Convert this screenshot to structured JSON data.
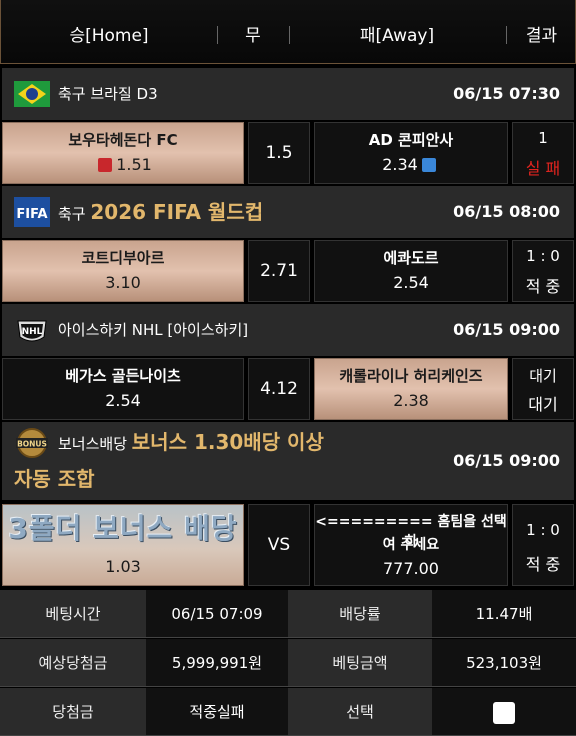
{
  "header": {
    "home": "승[Home]",
    "draw": "무",
    "away": "패[Away]",
    "result": "결과"
  },
  "matches": [
    {
      "sport_league": "축구 브라질 D3",
      "league_highlight": "",
      "datetime": "06/15 07:30",
      "icon": "brazil-flag-icon",
      "home": {
        "name": "보우타헤돈다 FC",
        "odds": "1.51",
        "selected": true
      },
      "draw": "1.5",
      "away": {
        "name": "AD 콘피안사",
        "odds": "2.34",
        "selected": false
      },
      "result_line1": "1",
      "result_line2": "실 패"
    },
    {
      "sport_league": "축구 ",
      "league_highlight": "2026 FIFA 월드컵",
      "datetime": "06/15 08:00",
      "icon": "fifa-logo-icon",
      "home": {
        "name": "코트디부아르",
        "odds": "3.10",
        "selected": true
      },
      "draw": "2.71",
      "away": {
        "name": "에콰도르",
        "odds": "2.54",
        "selected": false
      },
      "result_line1": "1 : 0",
      "result_line2": "적 중"
    },
    {
      "sport_league": "아이스하키 NHL [아이스하키]",
      "league_highlight": "",
      "datetime": "06/15 09:00",
      "icon": "nhl-logo-icon",
      "home": {
        "name": "베가스 골든나이츠",
        "odds": "2.54",
        "selected": false
      },
      "draw": "4.12",
      "away": {
        "name": "캐롤라이나 허리케인즈",
        "odds": "2.38",
        "selected": true
      },
      "result_line1": "대기",
      "result_line2": "대기"
    },
    {
      "sport_league": "보너스배당 ",
      "league_highlight": "보너스 1.30배당 이상",
      "league_highlight2": "자동 조합",
      "datetime": "06/15 09:00",
      "icon": "bonus-badge-icon",
      "home": {
        "name": "3폴더 보너스 배당",
        "odds": "1.03",
        "selected": true
      },
      "draw": "VS",
      "away": {
        "name_line1": "<========= 홈팀을 선택하",
        "name_line2": "여 주세요",
        "odds": "777.00",
        "selected": false
      },
      "result_line1": "1 : 0",
      "result_line2": "적 중"
    }
  ],
  "summary": {
    "bet_time_label": "베팅시간",
    "bet_time": "06/15 07:09",
    "odds_label": "배당률",
    "odds": "11.47배",
    "expected_label": "예상당첨금",
    "expected": "5,999,991원",
    "bet_amount_label": "베팅금액",
    "bet_amount": "523,103원",
    "winnings_label": "당첨금",
    "winnings": "적중실패",
    "select_label": "선택"
  },
  "colors": {
    "accent_gold": "#e2b76c",
    "fail_red": "#e2241f",
    "selected_bg": "#d8b6a2"
  }
}
